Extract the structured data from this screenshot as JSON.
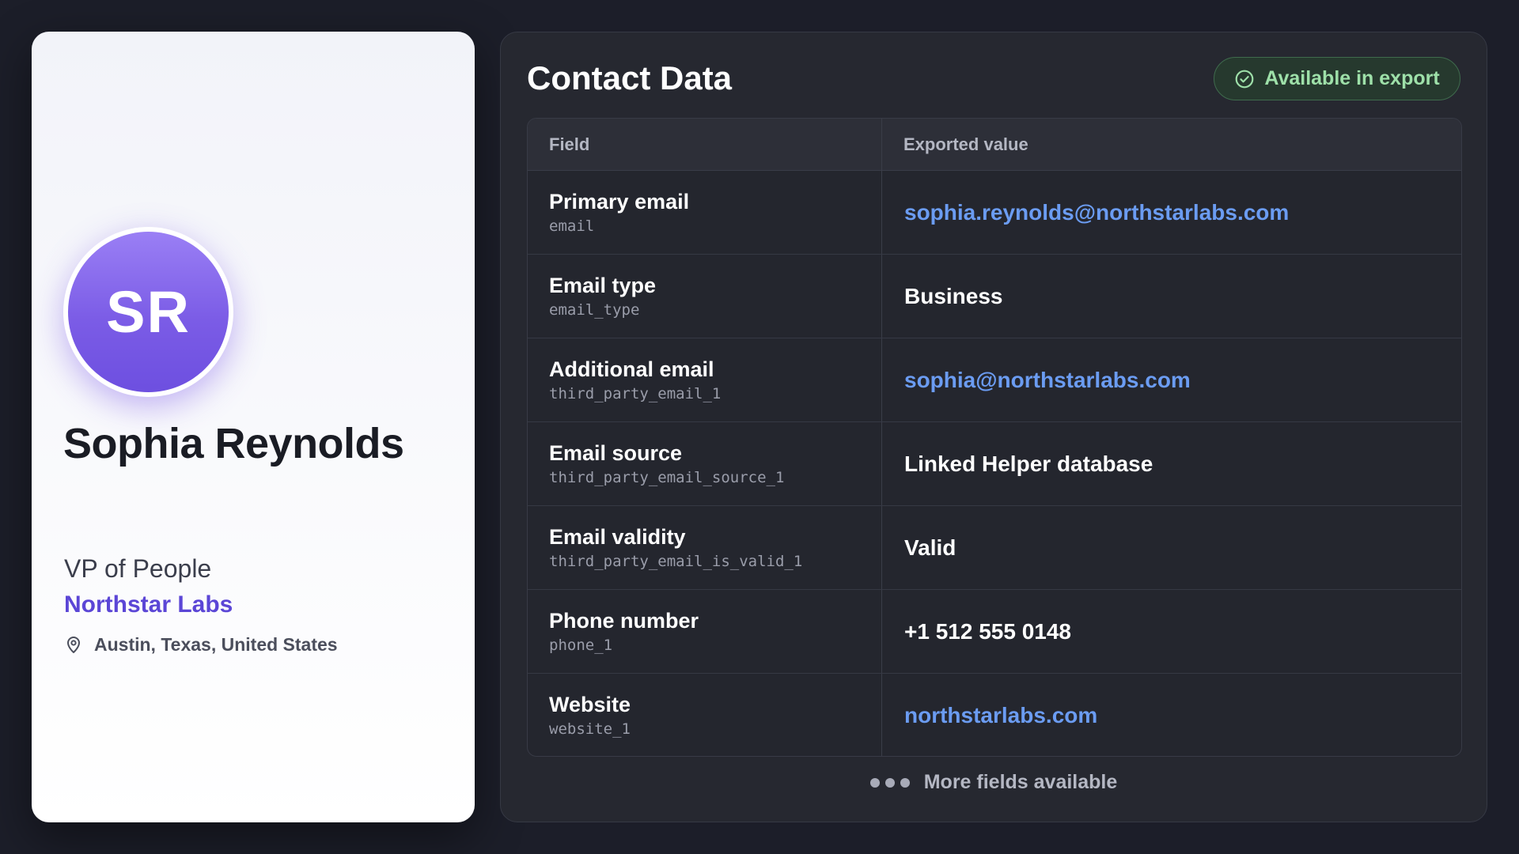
{
  "profile": {
    "initials": "SR",
    "name": "Sophia Reynolds",
    "title": "VP of People",
    "company": "Northstar Labs",
    "location": "Austin, Texas, United States"
  },
  "panel": {
    "title": "Contact Data",
    "badge_label": "Available in export",
    "badge_icon": "check-circle-icon",
    "table": {
      "headers": [
        "Field",
        "Exported value"
      ],
      "rows": [
        {
          "label": "Primary email",
          "key": "email",
          "value": "sophia.reynolds@northstarlabs.com",
          "is_link": true
        },
        {
          "label": "Email type",
          "key": "email_type",
          "value": "Business",
          "is_link": false
        },
        {
          "label": "Additional email",
          "key": "third_party_email_1",
          "value": "sophia@northstarlabs.com",
          "is_link": true
        },
        {
          "label": "Email source",
          "key": "third_party_email_source_1",
          "value": "Linked Helper database",
          "is_link": false
        },
        {
          "label": "Email validity",
          "key": "third_party_email_is_valid_1",
          "value": "Valid",
          "is_link": false
        },
        {
          "label": "Phone number",
          "key": "phone_1",
          "value": "+1 512 555 0148",
          "is_link": false
        },
        {
          "label": "Website",
          "key": "website_1",
          "value": "northstarlabs.com",
          "is_link": true
        }
      ]
    },
    "more_fields_label": "More fields available"
  },
  "colors": {
    "background": "#1c1e29",
    "accent": "#7b5ce6",
    "link": "#6b9cf2",
    "success": "#9ee0a9"
  }
}
